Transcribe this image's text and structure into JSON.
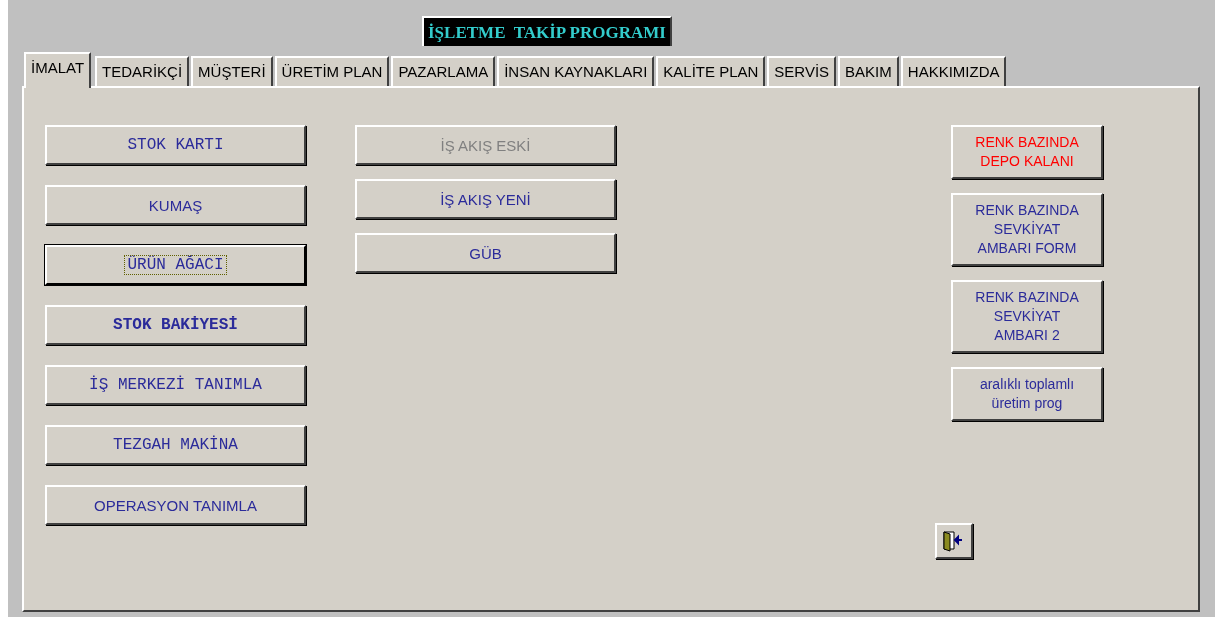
{
  "window": {
    "title": "İŞLETME  TAKİP PROGRAMI"
  },
  "tabs": [
    {
      "label": "İMALAT",
      "selected": true
    },
    {
      "label": "TEDARİKÇİ",
      "selected": false
    },
    {
      "label": "MÜŞTERİ",
      "selected": false
    },
    {
      "label": "ÜRETİM  PLAN",
      "selected": false
    },
    {
      "label": "PAZARLAMA",
      "selected": false
    },
    {
      "label": "İNSAN KAYNAKLARI",
      "selected": false
    },
    {
      "label": "KALİTE PLAN",
      "selected": false
    },
    {
      "label": "SERVİS",
      "selected": false
    },
    {
      "label": "BAKIM",
      "selected": false
    },
    {
      "label": "HAKKIMIZDA",
      "selected": false
    }
  ],
  "left_buttons": [
    {
      "label": "STOK KARTI",
      "kind": "typewriter",
      "focused": false
    },
    {
      "label": "KUMAŞ",
      "kind": "plain",
      "focused": false
    },
    {
      "label": "ÜRÜN AĞACI",
      "kind": "typewriter",
      "focused": true
    },
    {
      "label": "STOK BAKİYESİ",
      "kind": "typewriter-bold",
      "focused": false
    },
    {
      "label": "İŞ MERKEZİ TANIMLA",
      "kind": "typewriter",
      "focused": false
    },
    {
      "label": "TEZGAH MAKİNA",
      "kind": "typewriter",
      "focused": false
    },
    {
      "label": "OPERASYON TANIMLA",
      "kind": "plain",
      "focused": false
    }
  ],
  "middle_buttons": [
    {
      "label": "İŞ AKIŞ ESKİ",
      "disabled": true
    },
    {
      "label": "İŞ AKIŞ YENİ",
      "disabled": false
    },
    {
      "label": "GÜB",
      "disabled": false
    }
  ],
  "right_buttons": [
    {
      "lines": [
        "RENK BAZINDA",
        "DEPO KALANI"
      ],
      "color": "#ff0000"
    },
    {
      "lines": [
        "RENK BAZINDA",
        "SEVKİYAT",
        "AMBARI FORM"
      ],
      "color": "#2b2b9a"
    },
    {
      "lines": [
        "RENK BAZINDA",
        "SEVKİYAT",
        "AMBARI 2"
      ],
      "color": "#2b2b9a"
    },
    {
      "lines": [
        "aralıklı toplamlı",
        "üretim prog"
      ],
      "color": "#2b2b9a"
    }
  ]
}
